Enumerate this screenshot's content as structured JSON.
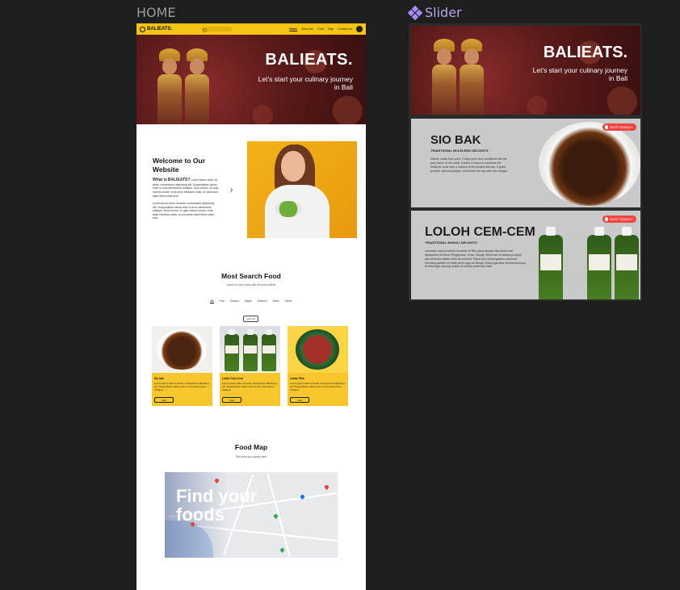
{
  "canvas": {
    "home_label": "HOME",
    "slider_label": "Slider"
  },
  "navbar": {
    "brand": "BALIEATS.",
    "links": [
      "Home",
      "About Us",
      "Food",
      "Map",
      "Contact Us"
    ]
  },
  "hero": {
    "title": "BALIEATS.",
    "subtitle": "Let's start your culinary journey in Bali"
  },
  "welcome": {
    "title": "Welcome to Our Website",
    "lead_prefix": "What is",
    "lead_brand": "BALIEATS?",
    "paragraph1": "Lorem ipsum dolor sit amet, consectetur adipiscing elit. Suspendisse varius enim in eros elementum tristique. Duis cursus, mi quis viverra ornare, eros dolor interdum nulla, ut commodo diam libero vitae erat.",
    "paragraph2": "Lorem ipsum dolor sit amet, consectetur adipiscing elit. Suspendisse varius enim in eros elementum tristique. Duis cursus, mi quis viverra ornare, eros dolor interdum nulla, ut commodo diam libero vitae erat."
  },
  "most_search": {
    "title": "Most Search Food",
    "subtitle": "search on your foods with the best reviews",
    "filters": [
      "All",
      "Pork",
      "Snacks",
      "Vegan",
      "Seafood",
      "Sides",
      "Drinks"
    ],
    "view_all": "View all",
    "cards": [
      {
        "name": "Sio bak",
        "desc": "Lorem ipsum dolor sit amet, consectetur adipiscing elit. Suspendisse varius enim in eros elementum tristique.",
        "button": "View"
      },
      {
        "name": "Loloh Cem-Cem",
        "desc": "Lorem ipsum dolor sit amet, consectetur adipiscing elit. Suspendisse varius enim in eros elementum tristique.",
        "button": "View"
      },
      {
        "name": "Lawar Plek",
        "desc": "Lorem ipsum dolor sit amet, consectetur adipiscing elit. Suspendisse varius enim in eros elementum tristique.",
        "button": "View"
      }
    ]
  },
  "food_map": {
    "title": "Food Map",
    "subtitle": "Find what you craving here",
    "map_heading": "Find your foods"
  },
  "slider": {
    "slide1": {
      "title": "BALIEATS.",
      "subtitle": "Let's start your culinary journey in Bali"
    },
    "slide2": {
      "badge": "MOST SEARCH",
      "title": "SIO BAK",
      "subtitle": "TRADITIONAL BULELENG DELIGHTS",
      "desc": "Dishes made from pork. Crispy pork skin combined with the juicy flavor of the meat. It takes 4 hours to marinate the tenderer meat with a mixture of fermented red tofu, 5 spice powder, salt and pepper, and brush the top with rice vinegar."
    },
    "slide3": {
      "badge": "MOST SEARCH",
      "title": "LOLOH CEM-CEM",
      "subtitle": "TRADITIONAL BANGLI DELIGHTS",
      "desc": "minuman hasil produksi rumahan di Bali yang banyak diproduksi dan dipasarkan di Desa Penglipuran, Kubu, Bangli. Minuman ini biasanya dijual dan diminum dalam botol air mineral. Rasa unik menyegarkan minuman memang jadikan ini tidak perlu ragu ke Bangli. Anda juga bisa menemukannya di beberapa warung makan di sekitar pedesaan Bali."
    }
  },
  "colors": {
    "accent": "#f6c514",
    "card": "#f7c52c",
    "badge": "#ef4444",
    "canvas": "#1e1e1e"
  }
}
